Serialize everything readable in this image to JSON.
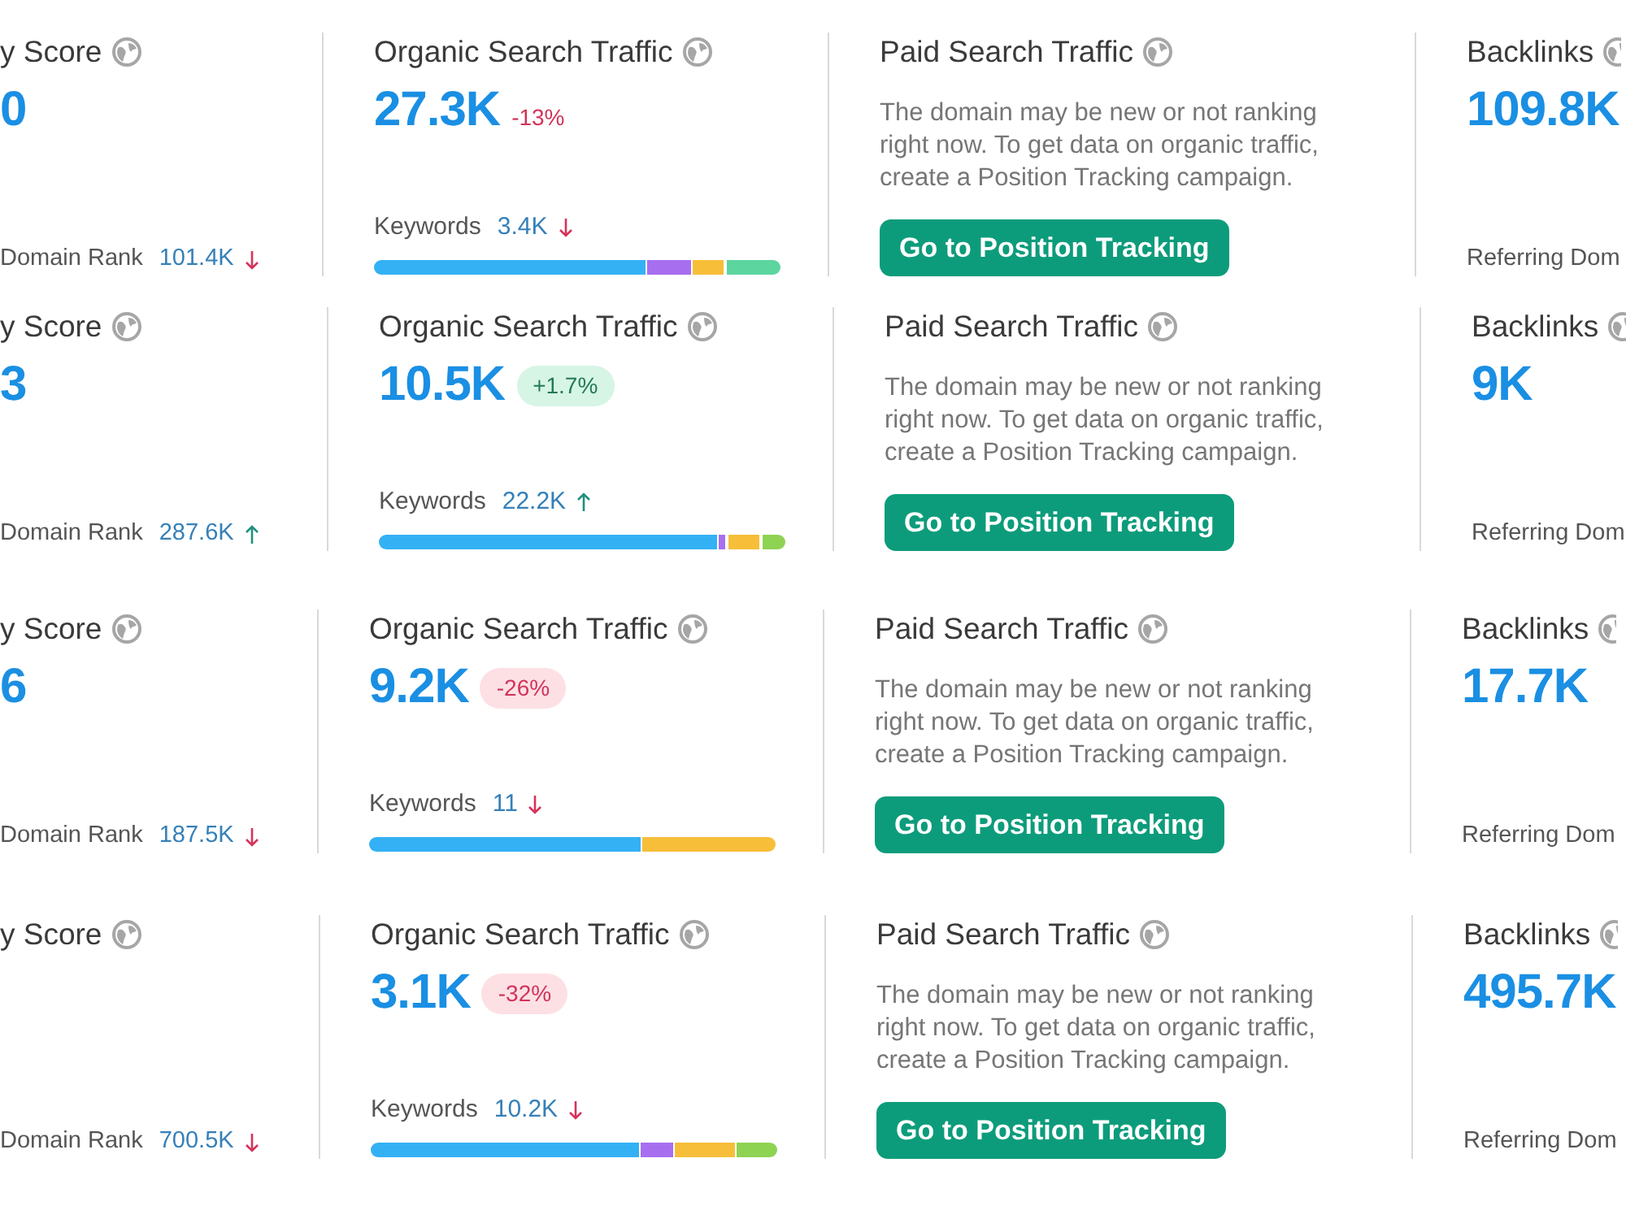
{
  "rows": [
    {
      "authority": {
        "title": "y Score",
        "value": "0",
        "rank_label": "Domain Rank",
        "rank_value": "101.4K",
        "rank_up": false
      },
      "organic": {
        "title": "Organic Search Traffic",
        "value": "27.3K",
        "change": {
          "text": "-13%",
          "kind": "plain",
          "up": false
        },
        "keywords_label": "Keywords",
        "keywords_value": "3.4K",
        "keywords_up": false
      },
      "paid": {
        "title": "Paid Search Traffic",
        "message": "The domain may be new or not ranking right now. To get data on organic traffic, create a Position Tracking campaign.",
        "button": "Go to Position Tracking"
      },
      "backlinks": {
        "title": "Backlinks",
        "value": "109.8K",
        "footer": "Referring Dom"
      }
    },
    {
      "authority": {
        "title": "y Score",
        "value": "3",
        "rank_label": "Domain Rank",
        "rank_value": "287.6K",
        "rank_up": true
      },
      "organic": {
        "title": "Organic Search Traffic",
        "value": "10.5K",
        "change": {
          "text": "+1.7%",
          "kind": "pill",
          "up": true
        },
        "keywords_label": "Keywords",
        "keywords_value": "22.2K",
        "keywords_up": true
      },
      "paid": {
        "title": "Paid Search Traffic",
        "message": "The domain may be new or not ranking right now. To get data on organic traffic, create a Position Tracking campaign.",
        "button": "Go to Position Tracking"
      },
      "backlinks": {
        "title": "Backlinks",
        "value": "9K",
        "footer": "Referring Dom"
      }
    },
    {
      "authority": {
        "title": "y Score",
        "value": "6",
        "rank_label": "Domain Rank",
        "rank_value": "187.5K",
        "rank_up": false
      },
      "organic": {
        "title": "Organic Search Traffic",
        "value": "9.2K",
        "change": {
          "text": "-26%",
          "kind": "pill",
          "up": false
        },
        "keywords_label": "Keywords",
        "keywords_value": "11",
        "keywords_up": false
      },
      "paid": {
        "title": "Paid Search Traffic",
        "message": "The domain may be new or not ranking right now. To get data on organic traffic, create a Position Tracking campaign.",
        "button": "Go to Position Tracking"
      },
      "backlinks": {
        "title": "Backlinks",
        "value": "17.7K",
        "footer": "Referring Dom"
      }
    },
    {
      "authority": {
        "title": "y Score",
        "rank_label": "Domain Rank",
        "rank_value": "700.5K",
        "rank_up": false
      },
      "organic": {
        "title": "Organic Search Traffic",
        "value": "3.1K",
        "change": {
          "text": "-32%",
          "kind": "pill",
          "up": false
        },
        "keywords_label": "Keywords",
        "keywords_value": "10.2K",
        "keywords_up": false
      },
      "paid": {
        "title": "Paid Search Traffic",
        "message": "The domain may be new or not ranking right now. To get data on organic traffic, create a Position Tracking campaign.",
        "button": "Go to Position Tracking"
      },
      "backlinks": {
        "title": "Backlinks",
        "value": "495.7K",
        "footer": "Referring Dom"
      }
    }
  ]
}
